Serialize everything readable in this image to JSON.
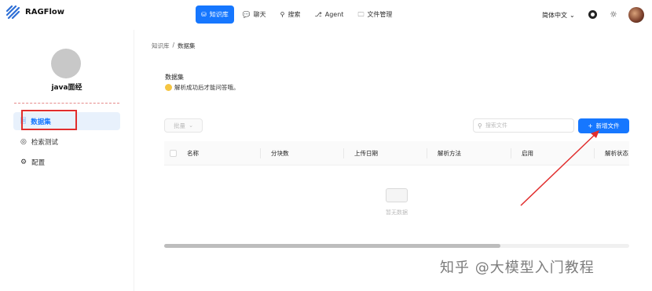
{
  "app": {
    "name": "RAGFlow"
  },
  "nav": {
    "items": [
      {
        "label": "知识库",
        "icon": "database-icon",
        "active": true
      },
      {
        "label": "聊天",
        "icon": "chat-icon",
        "active": false
      },
      {
        "label": "搜索",
        "icon": "search-icon",
        "active": false
      },
      {
        "label": "Agent",
        "icon": "agent-icon",
        "active": false
      },
      {
        "label": "文件管理",
        "icon": "folder-icon",
        "active": false
      }
    ],
    "language": "简体中文"
  },
  "sidebar": {
    "kb_name": "java面经",
    "items": [
      {
        "label": "数据集",
        "icon": "file-icon",
        "active": true
      },
      {
        "label": "检索测试",
        "icon": "target-icon",
        "active": false
      },
      {
        "label": "配置",
        "icon": "gear-icon",
        "active": false
      }
    ]
  },
  "breadcrumb": {
    "parent": "知识库",
    "separator": "/",
    "current": "数据集"
  },
  "section": {
    "title": "数据集",
    "description": "解析成功后才能问答哦。"
  },
  "toolbar": {
    "batch_label": "批量",
    "search_placeholder": "搜索文件",
    "add_label": "新增文件"
  },
  "table": {
    "columns": [
      "名称",
      "分块数",
      "上传日期",
      "解析方法",
      "启用",
      "解析状态"
    ],
    "empty_text": "暂无数据"
  },
  "watermark": "知乎 @大模型入门教程",
  "colors": {
    "accent": "#1677ff",
    "highlight": "#e12d2d"
  }
}
